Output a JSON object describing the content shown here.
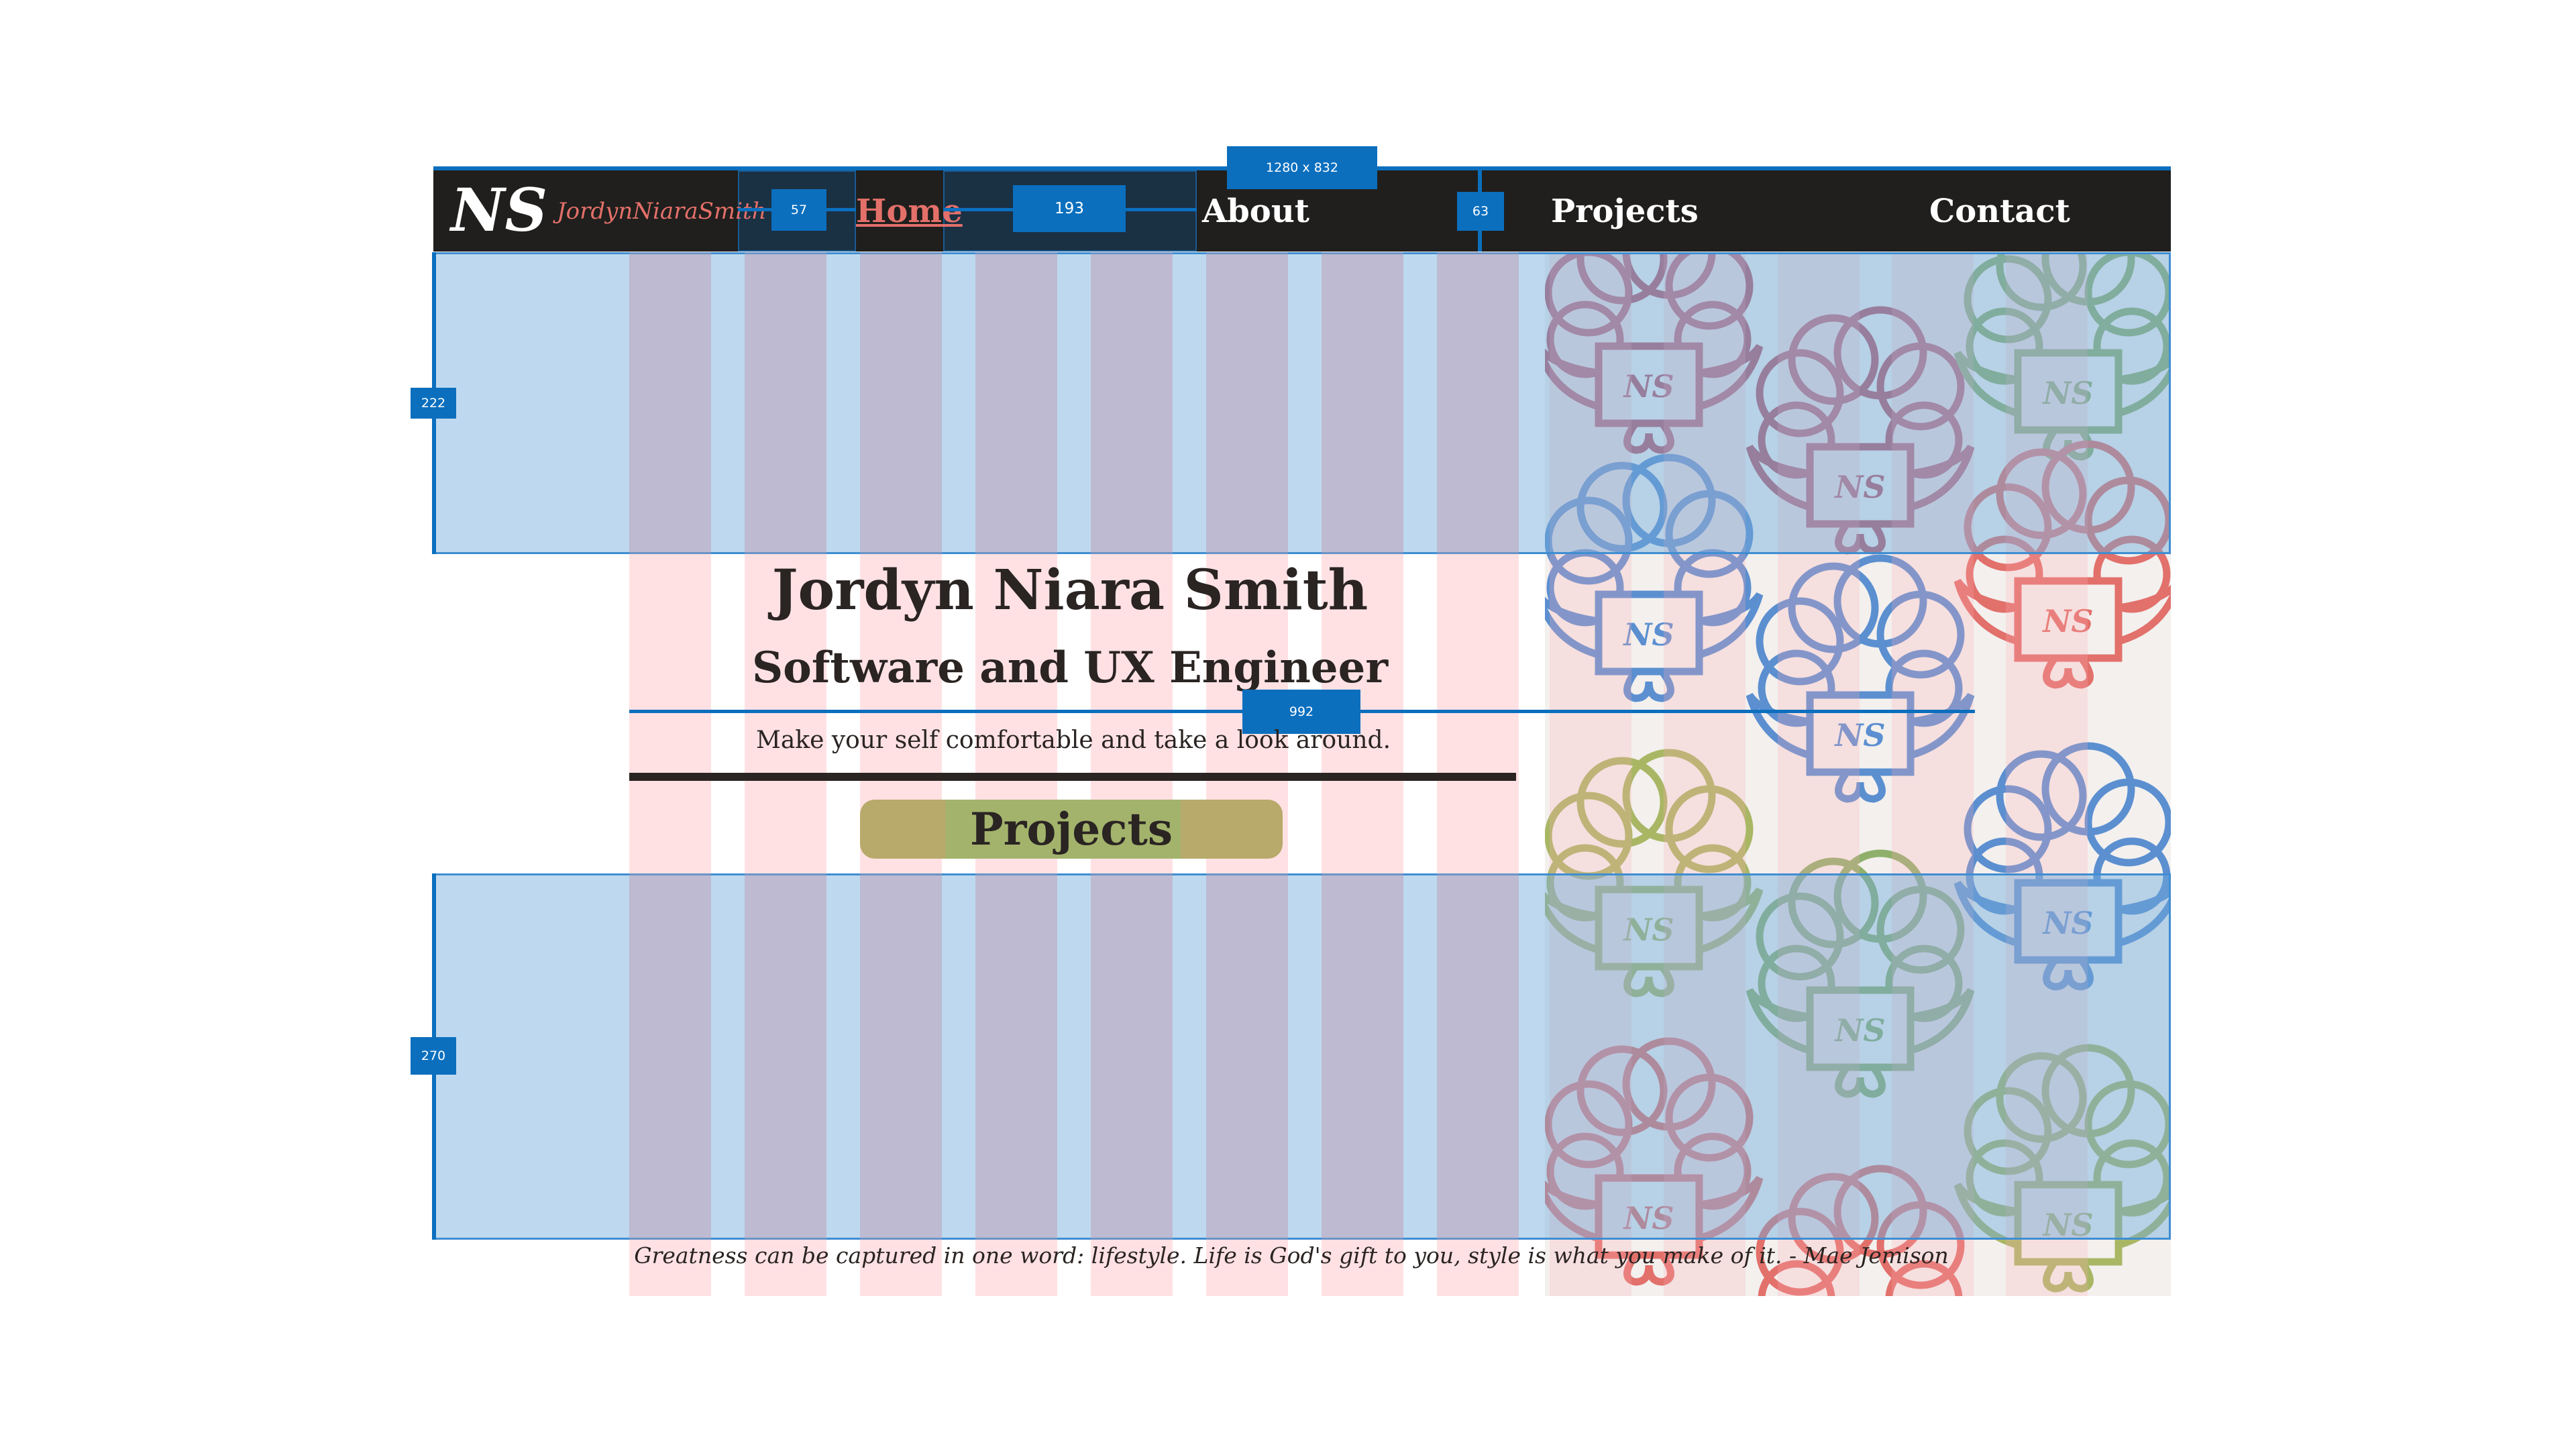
{
  "nav": {
    "logo_mark": "NS",
    "logo_wordmark": "JordynNiaraSmith",
    "links": [
      "Home",
      "About",
      "Projects",
      "Contact"
    ]
  },
  "hero": {
    "name": "Jordyn Niara Smith",
    "role": "Software and UX Engineer",
    "tagline": "Make your self comfortable and take a look around.",
    "button_label": "Projects"
  },
  "quote": "Greatness can be captured in one word: lifestyle. Life is God's gift to you, style is what you make of it. - Mae Jemison",
  "measurements": {
    "canvas": "1280 x 832",
    "gap_logo_nav": "57",
    "home_width": "193",
    "about_gap": "63",
    "top_band": "222",
    "bottom_band": "270",
    "content_width": "992"
  },
  "decor": {
    "monogram": "NS",
    "cloud_colors": [
      "#b85a6a",
      "#5b8fd0",
      "#8fb06b",
      "#e2706b",
      "#a9b765"
    ]
  },
  "colors": {
    "nav_bg": "#201f1d",
    "active_link": "#e4706a",
    "button_bg": "#b7aa6b",
    "guide_blue": "#0b6fbe"
  }
}
